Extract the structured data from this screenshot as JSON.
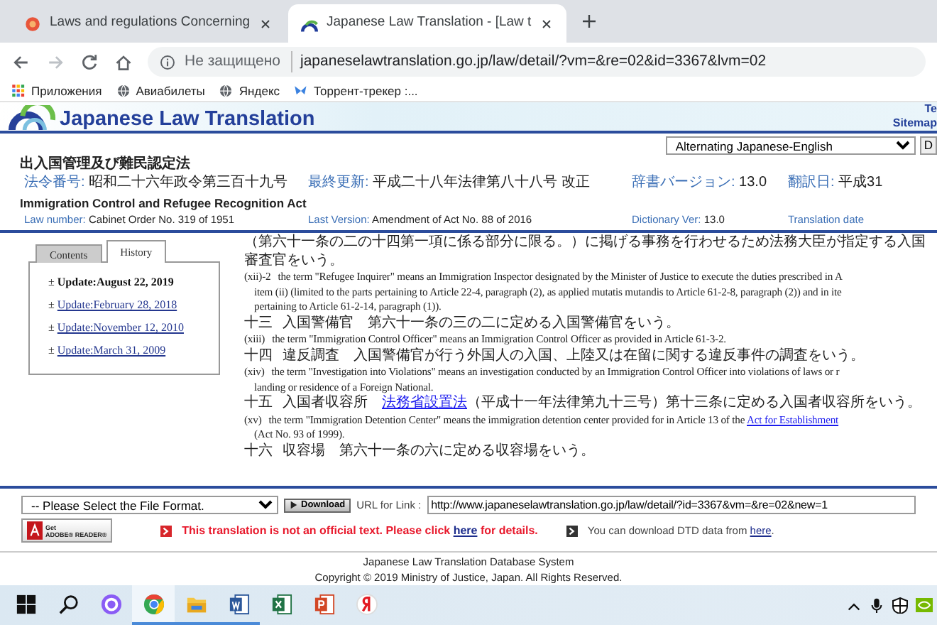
{
  "browser": {
    "tabs": [
      {
        "title": "Laws and regulations Concerning",
        "kind": "flower",
        "selected": false
      },
      {
        "title": "Japanese Law Translation - [Law t",
        "kind": "arcs",
        "selected": true
      }
    ],
    "address": {
      "security": "Не защищено",
      "url": "japaneselawtranslation.go.jp/law/detail/?vm=&re=02&id=3367&lvm=02"
    },
    "bookmarks": [
      {
        "label": "Приложения",
        "kind": "apps"
      },
      {
        "label": "Авиабилеты",
        "kind": "globe"
      },
      {
        "label": "Яндекс",
        "kind": "globe"
      },
      {
        "label": "Торрент-трекер :...",
        "kind": "butterfly"
      }
    ]
  },
  "site": {
    "logo": "Japanese Law Translation",
    "header_links": [
      "Te",
      "Sitemap"
    ],
    "display_select": "Alternating Japanese-English",
    "display_button": "D"
  },
  "law": {
    "title_ja": "出入国管理及び難民認定法",
    "meta_ja": [
      {
        "label": "法令番号:",
        "value": "昭和二十六年政令第三百十九号"
      },
      {
        "label": "最終更新:",
        "value": "平成二十八年法律第八十八号 改正"
      },
      {
        "label": "辞書バージョン:",
        "value": "13.0"
      },
      {
        "label": "翻訳日:",
        "value": "平成31"
      }
    ],
    "title_en": "Immigration Control and Refugee Recognition Act",
    "meta_en": [
      {
        "label": "Law number:",
        "value": "Cabinet Order No. 319 of 1951"
      },
      {
        "label": "Last Version:",
        "value": "Amendment of Act No. 88 of 2016"
      },
      {
        "label": "Dictionary Ver:",
        "value": "13.0"
      },
      {
        "label": "Translation date"
      }
    ]
  },
  "side_tabs": [
    {
      "label": "Contents",
      "selected": false
    },
    {
      "label": "History",
      "selected": true
    }
  ],
  "history": [
    {
      "sign": "±",
      "text": "Update:August 22, 2019",
      "selected": true
    },
    {
      "sign": "±",
      "text": "Update:February 28, 2018",
      "selected": false
    },
    {
      "sign": "±",
      "text": "Update:November 12, 2010",
      "selected": false
    },
    {
      "sign": "±",
      "text": "Update:March 31, 2009",
      "selected": false
    }
  ],
  "provisions": [
    {
      "kind": "ja",
      "lines": [
        [
          {
            "text": "（第六十一条の二の十四第一項に係る部分に限る。）に掲げる事務を行わせるため法務大臣が指定する入国審査官をいう。"
          }
        ]
      ]
    },
    {
      "kind": "en",
      "number": "(xii)-2",
      "lines": [
        [
          {
            "text": "the term \"Refugee Inquirer\" means an Immigration Inspector designated by the Minister of Justice to execute the duties prescribed in A"
          }
        ],
        [
          {
            "text": "item (ii) (limited to the parts pertaining to Article 22-4, paragraph (2), as applied mutatis mutandis to Article 61-2-8, paragraph (2)) and in ite"
          }
        ],
        [
          {
            "text": "pertaining to Article 61-2-14, paragraph (1))."
          }
        ]
      ]
    },
    {
      "kind": "ja",
      "number": "十三",
      "lines": [
        [
          {
            "text": "入国警備官　第六十一条の三の二に定める入国警備官をいう。"
          }
        ]
      ]
    },
    {
      "kind": "en",
      "number": "(xiii)",
      "lines": [
        [
          {
            "text": "the term \"Immigration Control Officer\" means an Immigration Control Officer as provided in Article 61-3-2."
          }
        ]
      ]
    },
    {
      "kind": "ja",
      "number": "十四",
      "lines": [
        [
          {
            "text": "違反調査　入国警備官が行う外国人の入国、上陸又は在留に関する違反事件の調査をいう。"
          }
        ]
      ]
    },
    {
      "kind": "en",
      "number": "(xiv)",
      "lines": [
        [
          {
            "text": "the term \"Investigation into Violations\" means an investigation conducted by an Immigration Control Officer into violations of laws or r"
          }
        ],
        [
          {
            "text": "landing or residence of a Foreign National."
          }
        ]
      ]
    },
    {
      "kind": "ja",
      "number": "十五",
      "lines": [
        [
          {
            "text": "入国者収容所　"
          },
          {
            "text": "法務省設置法",
            "link": true
          },
          {
            "text": "（平成十一年法律第九十三号）第十三条に定める入国者収容所をいう。"
          }
        ]
      ]
    },
    {
      "kind": "en",
      "number": "(xv)",
      "lines": [
        [
          {
            "text": "the term \"Immigration Detention Center\" means the immigration detention center provided for in Article 13 of the "
          },
          {
            "text": "Act for Establishment",
            "link": true
          }
        ],
        [
          {
            "text": "(Act No. 93 of 1999)."
          }
        ]
      ]
    },
    {
      "kind": "ja",
      "number": "十六",
      "lines": [
        [
          {
            "text": "収容場　第六十一条の六に定める収容場をいう。"
          }
        ]
      ]
    }
  ],
  "download": {
    "format_select": "-- Please Select the File Format.",
    "button": "Download",
    "url_label": "URL for Link :",
    "url": "http://www.japaneselawtranslation.go.jp/law/detail/?id=3367&vm=&re=02&new=1",
    "reader_badge": [
      "Get",
      "ADOBE® READER®"
    ],
    "notice": {
      "before": "This translation is not an official text. Please click ",
      "link": "here",
      "after": " for details."
    },
    "dtd": {
      "before": "You can download DTD data from ",
      "link": "here",
      "after": "."
    }
  },
  "footer": [
    "Japanese Law Translation Database System",
    "Copyright © 2019 Ministry of Justice, Japan. All Rights Reserved."
  ],
  "taskbar": [
    {
      "kind": "start",
      "running": false,
      "selected": false
    },
    {
      "kind": "search",
      "running": false,
      "selected": false
    },
    {
      "kind": "cortana",
      "running": false,
      "selected": false
    },
    {
      "kind": "chrome",
      "running": true,
      "selected": true
    },
    {
      "kind": "explorer",
      "running": true,
      "selected": false
    },
    {
      "kind": "word",
      "running": true,
      "selected": false
    },
    {
      "kind": "excel",
      "running": false,
      "selected": false
    },
    {
      "kind": "powerpoint",
      "running": false,
      "selected": false
    },
    {
      "kind": "yandex",
      "running": false,
      "selected": false
    }
  ]
}
